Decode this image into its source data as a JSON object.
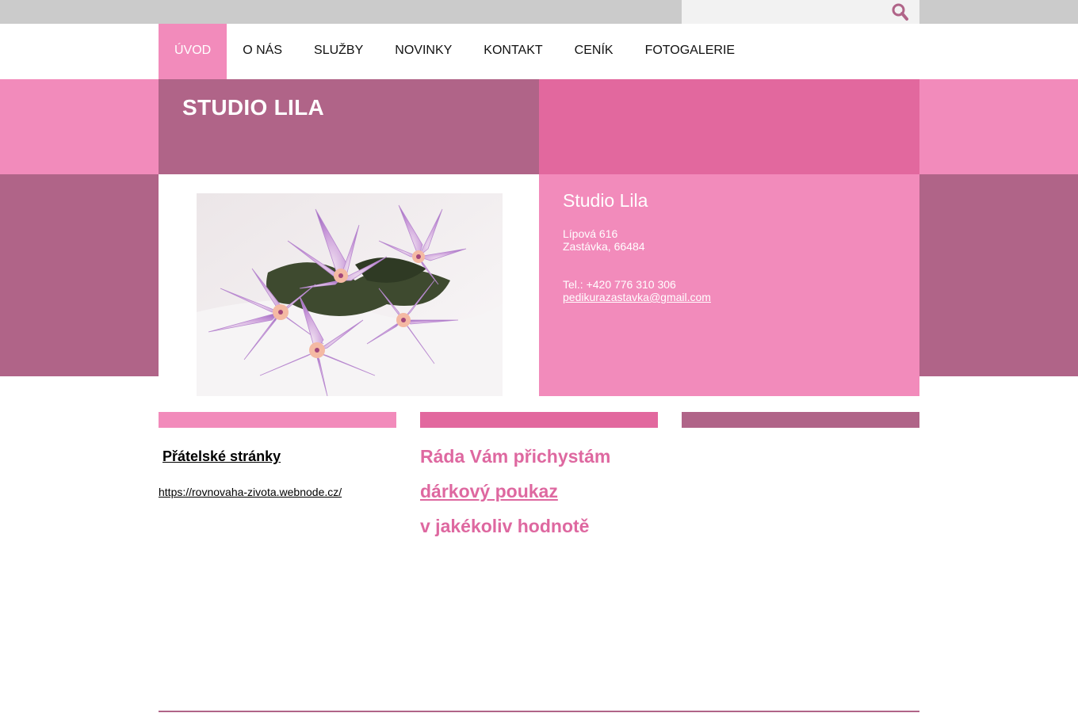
{
  "search": {
    "value": "",
    "placeholder": ""
  },
  "nav": {
    "items": [
      {
        "label": "ÚVOD",
        "active": true
      },
      {
        "label": "O NÁS",
        "active": false
      },
      {
        "label": "SLUŽBY",
        "active": false
      },
      {
        "label": "NOVINKY",
        "active": false
      },
      {
        "label": "KONTAKT",
        "active": false
      },
      {
        "label": "CENÍK",
        "active": false
      },
      {
        "label": "FOTOGALERIE",
        "active": false
      }
    ]
  },
  "header": {
    "title": "STUDIO LILA"
  },
  "contact": {
    "name": "Studio Lila",
    "street": "Lípová 616",
    "city": "Zastávka, 66484",
    "phone": "Tel.: +420 776 310 306",
    "email": "pedikurazastavka@gmail.com"
  },
  "friends": {
    "title": "Přátelské stránky",
    "link": "https://rovnovaha-zivota.webnode.cz/"
  },
  "promo": {
    "line1": "Ráda Vám přichystám",
    "line2": "dárkový poukaz",
    "line3": "v jakékoliv hodnotě"
  },
  "colors": {
    "pink_light": "#f28bbb",
    "pink_medium": "#e2689e",
    "mauve": "#b06488",
    "topbar_gray": "#cbcbcb",
    "promo_text": "#de68a0"
  },
  "icons": {
    "search": "magnifier-icon",
    "photo": "lotus-flowers-photo"
  }
}
